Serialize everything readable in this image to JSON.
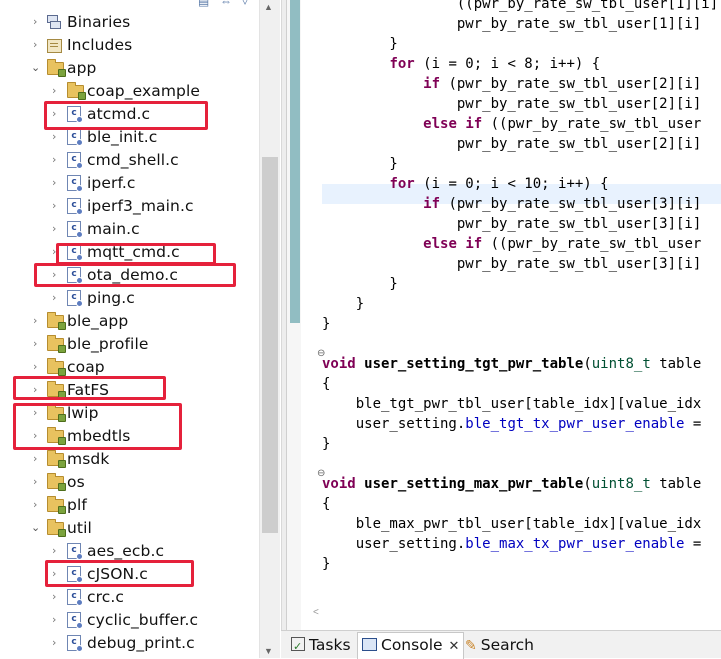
{
  "explorer": {
    "items": [
      {
        "label": "Binaries",
        "kind": "binaries",
        "expanded": false
      },
      {
        "label": "Includes",
        "kind": "includes",
        "expanded": false
      },
      {
        "label": "app",
        "kind": "folder",
        "expanded": true
      },
      {
        "label": "coap_example",
        "kind": "folder",
        "expanded": false
      },
      {
        "label": "atcmd.c",
        "kind": "c-file",
        "expanded": false
      },
      {
        "label": "ble_init.c",
        "kind": "c-file",
        "expanded": false
      },
      {
        "label": "cmd_shell.c",
        "kind": "c-file",
        "expanded": false
      },
      {
        "label": "iperf.c",
        "kind": "c-file",
        "expanded": false
      },
      {
        "label": "iperf3_main.c",
        "kind": "c-file",
        "expanded": false
      },
      {
        "label": "main.c",
        "kind": "c-file",
        "expanded": false
      },
      {
        "label": "mqtt_cmd.c",
        "kind": "c-file",
        "expanded": false
      },
      {
        "label": "ota_demo.c",
        "kind": "c-file",
        "expanded": false
      },
      {
        "label": "ping.c",
        "kind": "c-file",
        "expanded": false
      },
      {
        "label": "ble_app",
        "kind": "folder",
        "expanded": false
      },
      {
        "label": "ble_profile",
        "kind": "folder",
        "expanded": false
      },
      {
        "label": "coap",
        "kind": "folder",
        "expanded": false
      },
      {
        "label": "FatFS",
        "kind": "folder",
        "expanded": false
      },
      {
        "label": "lwip",
        "kind": "folder",
        "expanded": false
      },
      {
        "label": "mbedtls",
        "kind": "folder",
        "expanded": false
      },
      {
        "label": "msdk",
        "kind": "folder",
        "expanded": false
      },
      {
        "label": "os",
        "kind": "folder",
        "expanded": false
      },
      {
        "label": "plf",
        "kind": "folder",
        "expanded": false
      },
      {
        "label": "util",
        "kind": "folder",
        "expanded": true
      },
      {
        "label": "aes_ecb.c",
        "kind": "c-file",
        "expanded": false
      },
      {
        "label": "cJSON.c",
        "kind": "c-file",
        "expanded": false
      },
      {
        "label": "crc.c",
        "kind": "c-file",
        "expanded": false
      },
      {
        "label": "cyclic_buffer.c",
        "kind": "c-file",
        "expanded": false
      },
      {
        "label": "debug_print.c",
        "kind": "c-file",
        "expanded": false
      }
    ],
    "highlight_color": "#e5213b"
  },
  "editor": {
    "lines": [
      "                ((pwr_by_rate_sw_tbl_user[1][i]",
      "                pwr_by_rate_sw_tbl_user[1][i]",
      "        }",
      "        for (i = 0; i < 8; i++) {",
      "            if (pwr_by_rate_sw_tbl_user[2][i]",
      "                pwr_by_rate_sw_tbl_user[2][i]",
      "            else if ((pwr_by_rate_sw_tbl_user",
      "                pwr_by_rate_sw_tbl_user[2][i]",
      "        }",
      "        for (i = 0; i < 10; i++) {",
      "            if (pwr_by_rate_sw_tbl_user[3][i]",
      "                pwr_by_rate_sw_tbl_user[3][i]",
      "            else if ((pwr_by_rate_sw_tbl_user",
      "                pwr_by_rate_sw_tbl_user[3][i]",
      "        }",
      "    }",
      "}",
      "",
      "void user_setting_tgt_pwr_table(uint8_t table",
      "{",
      "    ble_tgt_pwr_tbl_user[table_idx][value_idx",
      "    user_setting.ble_tgt_tx_pwr_user_enable =",
      "}",
      "",
      "void user_setting_max_pwr_table(uint8_t table",
      "{",
      "    ble_max_pwr_tbl_user[table_idx][value_idx",
      "    user_setting.ble_max_tx_pwr_user_enable =",
      "}"
    ],
    "keyword_color": "#7f0055",
    "type_color": "#005032",
    "field_color": "#0000c0",
    "current_line_color": "#e8f2fe"
  },
  "bottom_tabs": [
    {
      "label": "Tasks",
      "icon": "tasks-icon"
    },
    {
      "label": "Console",
      "icon": "console-icon",
      "active": true
    },
    {
      "label": "Search",
      "icon": "search-icon"
    }
  ]
}
